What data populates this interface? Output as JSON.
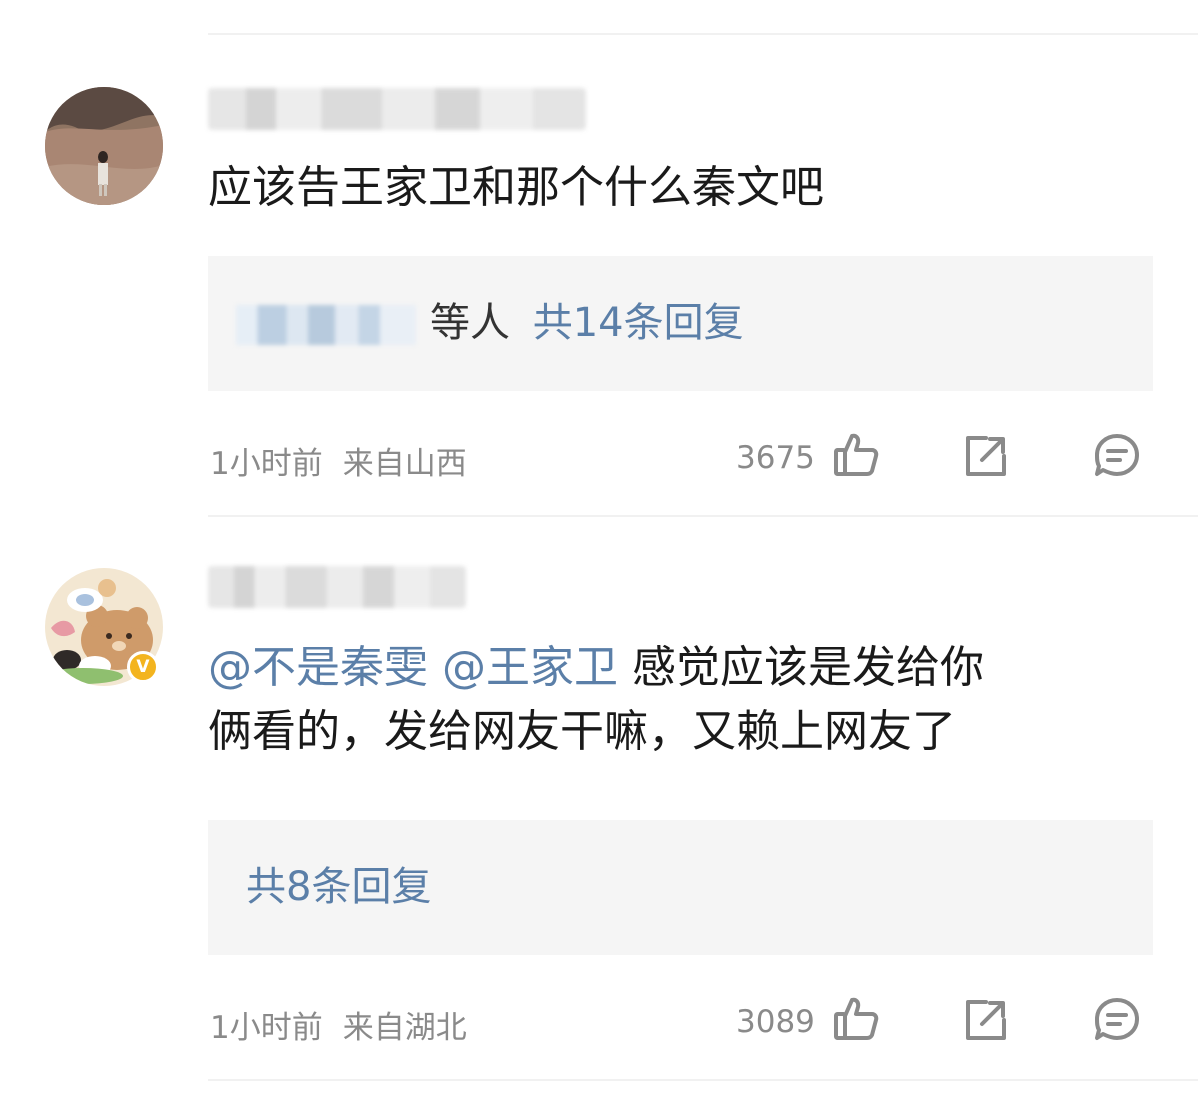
{
  "comments": [
    {
      "text": "应该告王家卫和那个什么秦文吧",
      "reply_users": "等人",
      "reply_count": "共14条回复",
      "time": "1小时前",
      "location": "来自山西",
      "likes": "3675",
      "verified": false
    },
    {
      "mention1": "@不是秦雯",
      "mention2": "@王家卫",
      "text_line1": "感觉应该是发给你",
      "text_line2": "俩看的，发给网友干嘛，又赖上网友了",
      "reply_count": "共8条回复",
      "time": "1小时前",
      "location": "来自湖北",
      "likes": "3089",
      "verified": true,
      "verified_badge": "V"
    }
  ],
  "icons": {
    "like": "thumbs-up-icon",
    "share": "share-icon",
    "comment": "comment-icon"
  },
  "colors": {
    "link": "#5b7fa8",
    "meta": "#8a8a8a",
    "badge": "#f3b41f"
  }
}
